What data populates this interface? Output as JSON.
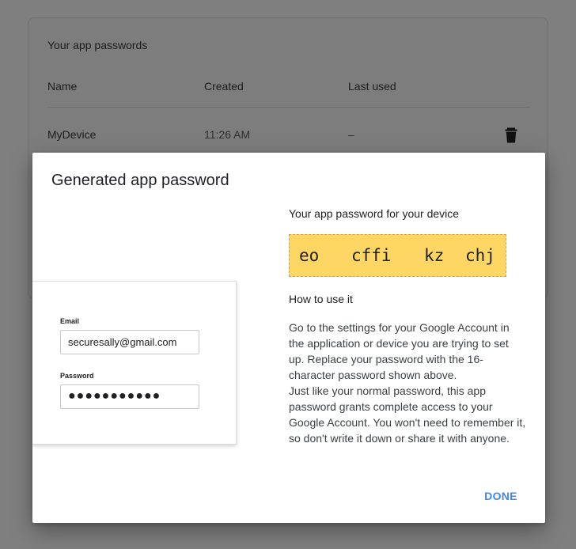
{
  "background": {
    "section_title": "Your app passwords",
    "columns": {
      "name": "Name",
      "created": "Created",
      "last_used": "Last used"
    },
    "rows": [
      {
        "name": "MyDevice",
        "created": "11:26 AM",
        "last_used": "–",
        "delete_icon": "trash-icon"
      }
    ]
  },
  "dialog": {
    "title": "Generated app password",
    "illustration": {
      "email_label": "Email",
      "email_value": "securesally@gmail.com",
      "password_label": "Password",
      "password_value": "●●●●●●●●●●●"
    },
    "password_heading": "Your app password for your device",
    "password_groups": [
      "eo",
      "cffi",
      "kz",
      "chj"
    ],
    "howto_heading": "How to use it",
    "howto_paragraphs": [
      "Go to the settings for your Google Account in the application or device you are trying to set up. Replace your password with the 16-character password shown above.",
      "Just like your normal password, this app password grants complete access to your Google Account. You won't need to remember it, so don't write it down or share it with anyone."
    ],
    "done_label": "DONE"
  },
  "colors": {
    "password_highlight": "#fdd663",
    "accent_blue": "#4285f4",
    "scrim": "#7f7f7f"
  }
}
